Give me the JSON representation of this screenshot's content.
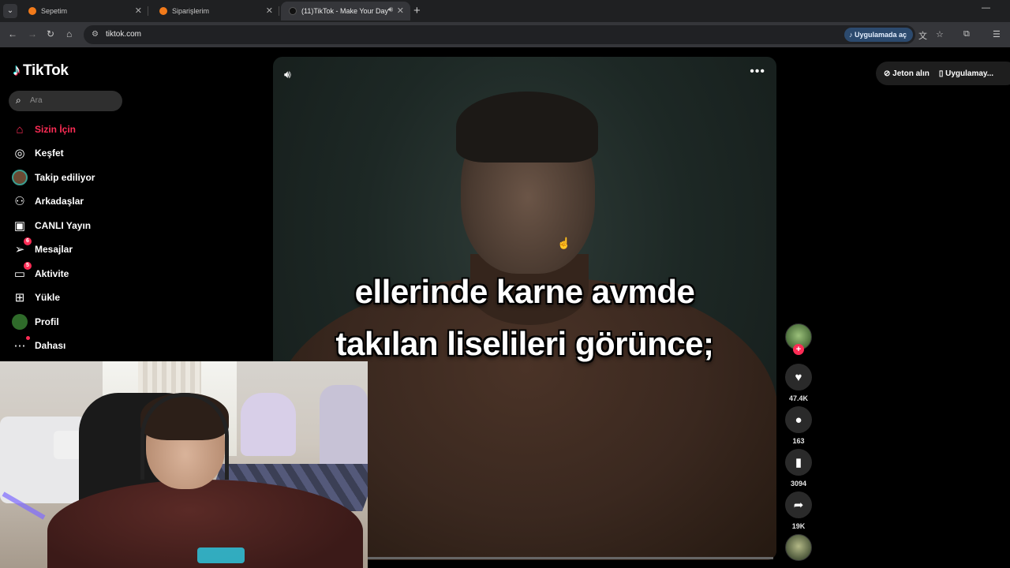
{
  "browser": {
    "tabs": [
      {
        "title": "Sepetim",
        "active": false
      },
      {
        "title": "Siparişlerim",
        "active": false
      },
      {
        "title": "(11)TikTok - Make Your Day",
        "active": true
      }
    ],
    "url": "tiktok.com",
    "open_in_app": "Uygulamada aç"
  },
  "sidebar": {
    "logo": "TikTok",
    "search_placeholder": "Ara",
    "items": [
      {
        "label": "Sizin İçin",
        "icon": "home-icon",
        "active": true
      },
      {
        "label": "Keşfet",
        "icon": "compass-icon"
      },
      {
        "label": "Takip ediliyor",
        "icon": "avatar-icon"
      },
      {
        "label": "Arkadaşlar",
        "icon": "friends-icon"
      },
      {
        "label": "CANLI Yayın",
        "icon": "live-icon"
      },
      {
        "label": "Mesajlar",
        "icon": "messages-icon",
        "badge": "6"
      },
      {
        "label": "Aktivite",
        "icon": "activity-icon",
        "badge": "5"
      },
      {
        "label": "Yükle",
        "icon": "upload-icon"
      },
      {
        "label": "Profil",
        "icon": "profile-icon"
      },
      {
        "label": "Dahası",
        "icon": "more-icon"
      }
    ]
  },
  "header": {
    "coins": "Jeton alın",
    "app": "Uygulamay..."
  },
  "video": {
    "caption_line1": "ellerinde karne avmde",
    "caption_line2": "takılan liselileri görünce;",
    "progress": 0.18
  },
  "actions": {
    "likes": "47.4K",
    "comments": "163",
    "saves": "3094",
    "shares": "19K"
  }
}
